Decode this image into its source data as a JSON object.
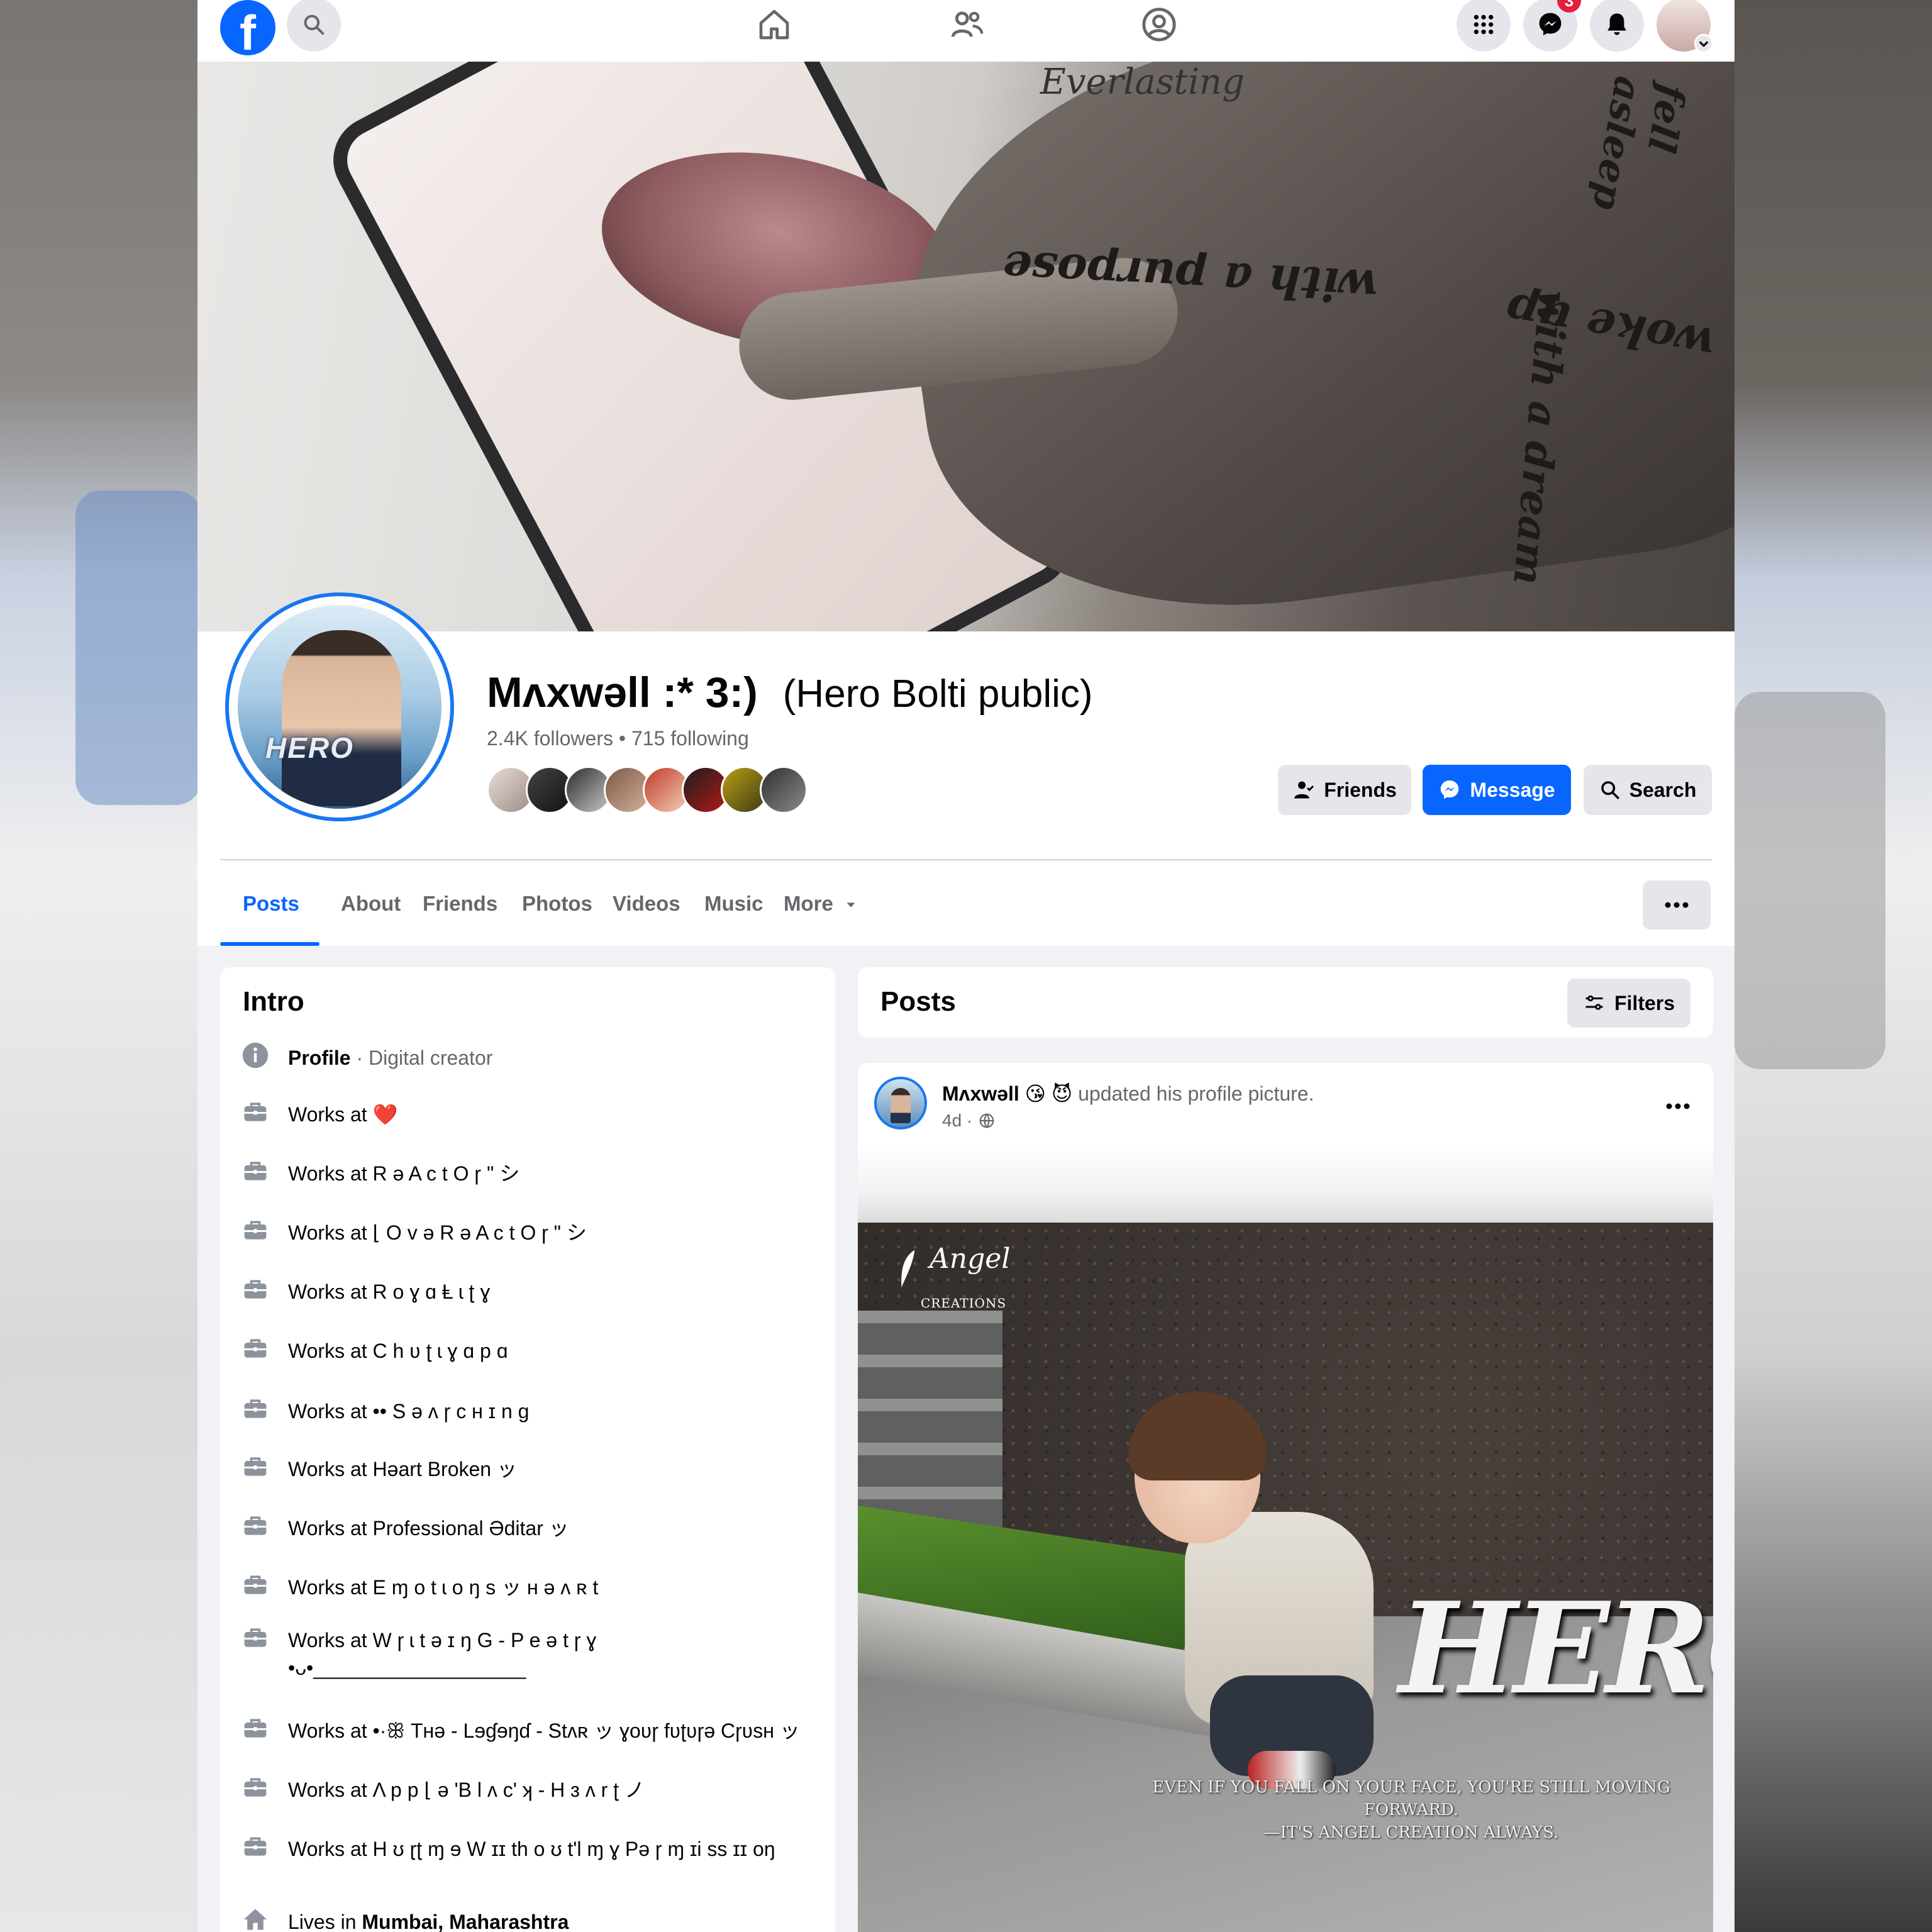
{
  "topbar": {
    "logo": "f",
    "messenger_badge": "3"
  },
  "cover": {
    "tattoo_line_1": "with a purpose",
    "tattoo_line_2": "woke up",
    "tattoo_line_3": "with a dream",
    "tattoo_line_4": "fell asleep",
    "signature": "Everlasting"
  },
  "profile": {
    "name": "Mʌxwəll :* 3:)",
    "alt_name": "(Hero Bolti public)",
    "followers": "2.4K followers",
    "following": "715 following",
    "separator": " • ",
    "avatar_text": "HERO"
  },
  "actions": {
    "friends_label": "Friends",
    "message_label": "Message",
    "search_label": "Search"
  },
  "tabs": [
    {
      "label": "Posts"
    },
    {
      "label": "About"
    },
    {
      "label": "Friends"
    },
    {
      "label": "Photos"
    },
    {
      "label": "Videos"
    },
    {
      "label": "Music"
    },
    {
      "label": "More"
    }
  ],
  "intro": {
    "title": "Intro",
    "profile_label": "Profile",
    "profile_value": " · Digital creator",
    "items": [
      {
        "text": "Works at ❤️"
      },
      {
        "text": "Works at R ə A c t O ɼ \" シ"
      },
      {
        "text": "Works at ⌊ O v ə R ə A c t O ɼ \" シ"
      },
      {
        "text": "Works at R o ɣ ɑ Ⱡ ɩ ʈ ɣ"
      },
      {
        "text": "Works at C h ʋ ʈ ɩ ɣ ɑ p ɑ"
      },
      {
        "text": "Works at •• S ə ʌ ɼ ᴄ ʜ ɪ n g"
      },
      {
        "text": "Works at Həart Broken ッ"
      },
      {
        "text": "Works at Professional Əditar ッ"
      },
      {
        "text": "Works at E ɱ o t ɩ o ŋ s ッ ʜ ә ʌ ʀ t"
      },
      {
        "text": "Works at W ɼ ɩ t ə ɪ ŋ G - P e ə t ɼ ɣ •ᴗ•___________________"
      },
      {
        "text": "Works at •·ꕥ Tʜə - Lɘɠɘŋɗ - Stʌʀ ッ ɣoʋɼ fʋʈʋɼə Cɼʋsʜ ッ"
      },
      {
        "text": "Works at Λ p p ⌊ ə 'B l ʌ c' ʞ - H ɜ ʌ r ʈ ノ"
      },
      {
        "text": "Works at H ʊ ɽʈ ɱ ɘ W ɪɪ th o ʊ t'l ɱ ɣ Pə ɼ ɱ ɪi ss ɪɪ oŋ"
      }
    ],
    "lives_prefix": "Lives in ",
    "lives_place": "Mumbai, Maharashtra"
  },
  "posts": {
    "title": "Posts",
    "filters_label": "Filters"
  },
  "post": {
    "author": "Mʌxwəll 😘 😈",
    "action": " updated his profile picture.",
    "time": "4d ·",
    "watermark_brand": "Angel",
    "watermark_sub": "CREATIONS",
    "hero_word": "HERO",
    "quote_line_1": "EVEN IF YOU FALL ON YOUR FACE, YOU'RE STILL MOVING FORWARD.",
    "quote_line_2": "—IT'S ANGEL CREATION ALWAYS."
  },
  "colors": {
    "brand": "#0866ff",
    "page_bg": "#f0f2f5",
    "secondary_text": "#65676b",
    "badge": "#e41e3f"
  }
}
